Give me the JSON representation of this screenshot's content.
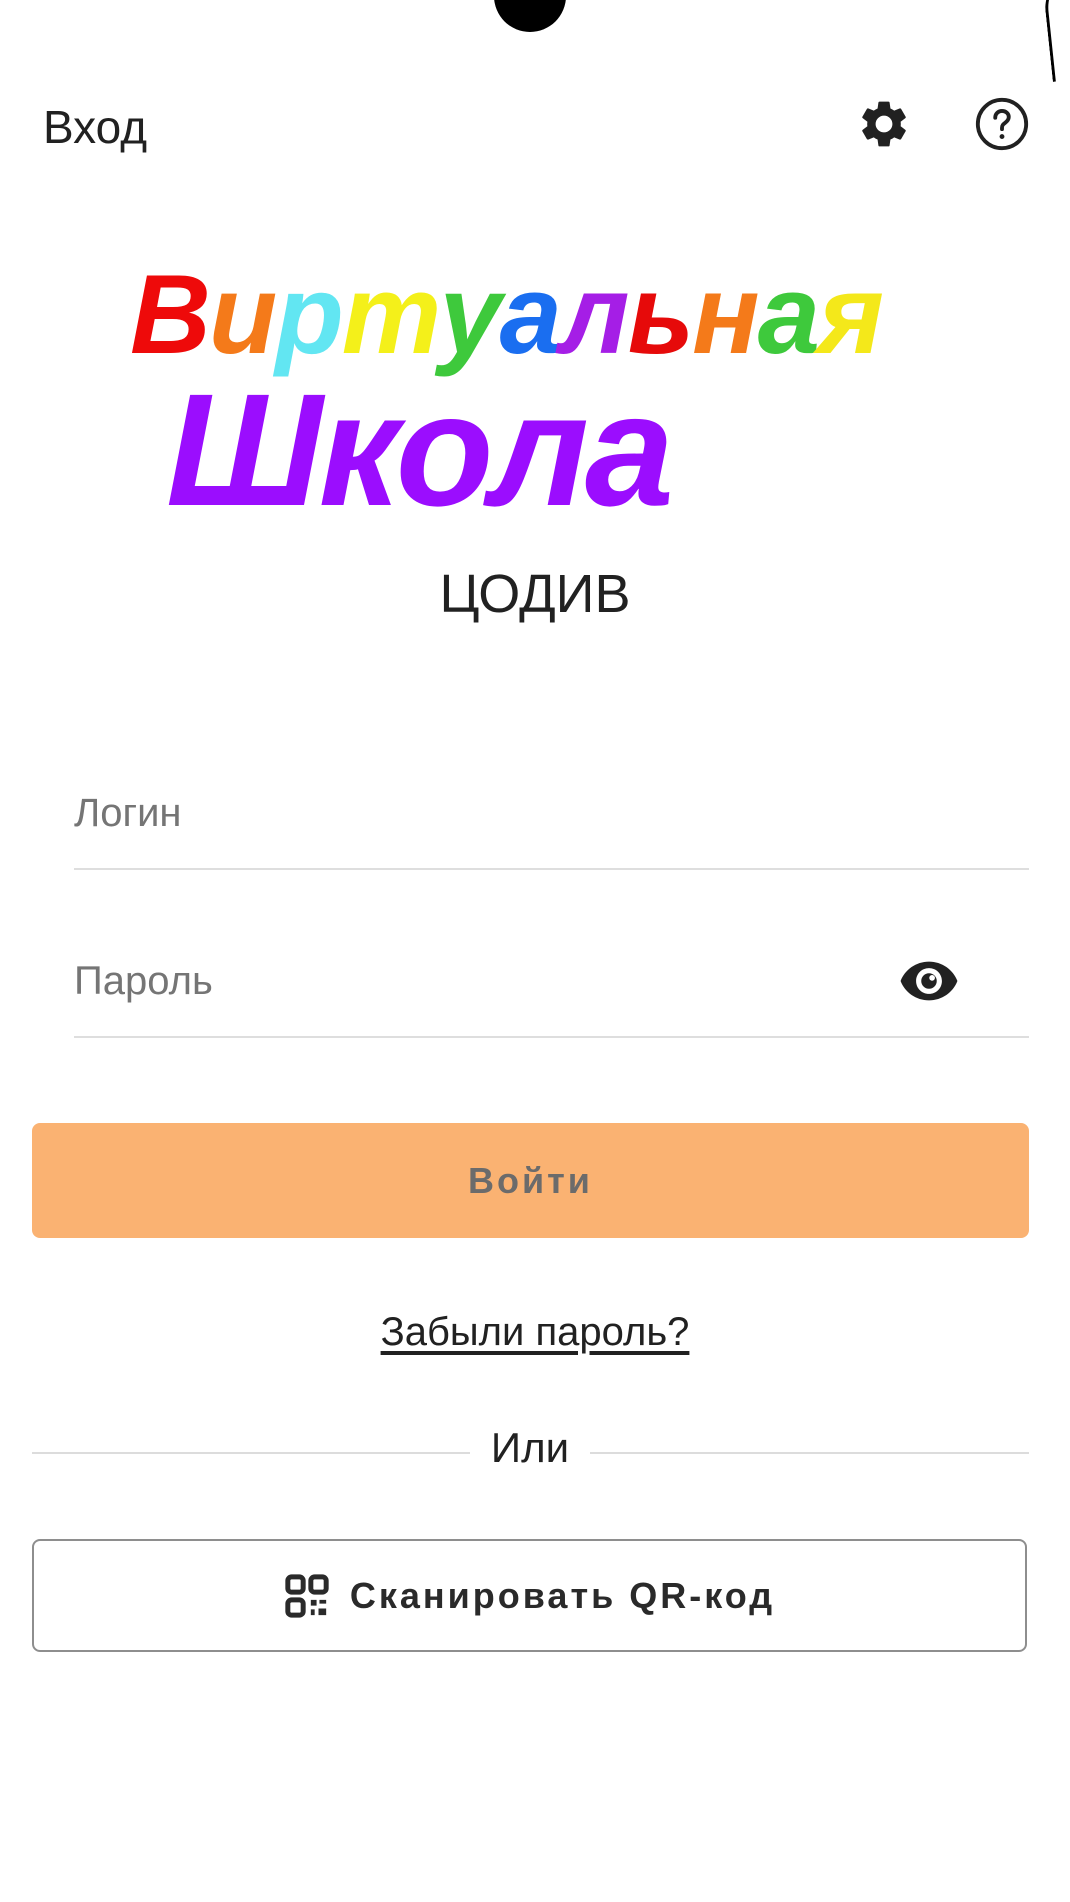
{
  "header": {
    "title": "Вход",
    "settings_icon": "gear-icon",
    "help_icon": "help-circle-icon"
  },
  "logo": {
    "line1_letters": [
      {
        "char": "В",
        "color": "#ee0a0a"
      },
      {
        "char": "и",
        "color": "#f47a1a"
      },
      {
        "char": "р",
        "color": "#62e6f2"
      },
      {
        "char": "т",
        "color": "#f4f01a"
      },
      {
        "char": "у",
        "color": "#3ec93c"
      },
      {
        "char": "а",
        "color": "#1a6ef0"
      },
      {
        "char": "л",
        "color": "#a51ee6"
      },
      {
        "char": "ь",
        "color": "#e60a0a"
      },
      {
        "char": "н",
        "color": "#f47a1a"
      },
      {
        "char": "а",
        "color": "#3ec93c"
      },
      {
        "char": "я",
        "color": "#f4e81a"
      }
    ],
    "line2": "Школа",
    "line2_color": "#9b0dfe"
  },
  "org_name": "ЦОДИВ",
  "form": {
    "login_placeholder": "Логин",
    "login_value": "",
    "password_placeholder": "Пароль",
    "password_value": "",
    "show_password_icon": "eye-icon",
    "submit_label": "Войти"
  },
  "forgot_password": "Забыли пароль?",
  "divider_text": "Или",
  "qr": {
    "icon": "qr-code-icon",
    "label": "Сканировать QR-код"
  },
  "colors": {
    "accent": "#fab272",
    "button_text": "#6b6b6b"
  }
}
